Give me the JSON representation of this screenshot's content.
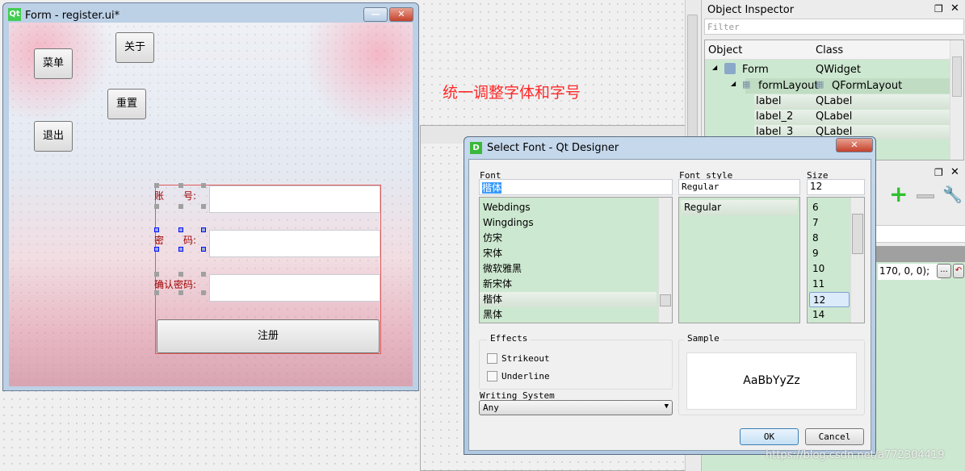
{
  "form_window": {
    "title": "Form - register.ui*",
    "buttons": {
      "menu": "菜单",
      "about": "关于",
      "reset": "重置",
      "exit": "退出",
      "register": "注册"
    },
    "labels": {
      "account": "账　　号:",
      "password": "密　　码:",
      "confirm": "确认密码:"
    }
  },
  "annotation": "统一调整字体和字号",
  "object_inspector": {
    "title": "Object Inspector",
    "filter_placeholder": "Filter",
    "columns": [
      "Object",
      "Class"
    ],
    "rows": [
      {
        "object": "Form",
        "class": "QWidget"
      },
      {
        "object": "formLayout",
        "class": "QFormLayout"
      },
      {
        "object": "label",
        "class": "QLabel"
      },
      {
        "object": "label_2",
        "class": "QLabel"
      },
      {
        "object": "label_3",
        "class": "QLabel"
      }
    ]
  },
  "property_editor": {
    "value_fragment": "170, 0, 0);",
    "more_label": "..."
  },
  "font_dialog": {
    "title": "Select Font - Qt Designer",
    "font_label": "Font",
    "font_value": "楷体",
    "fonts": [
      "Webdings",
      "Wingdings",
      "仿宋",
      "宋体",
      "微软雅黑",
      "新宋体",
      "楷体",
      "黑体"
    ],
    "selected_font": "楷体",
    "style_label": "Font style",
    "style_value": "Regular",
    "styles": [
      "Regular"
    ],
    "size_label": "Size",
    "size_value": "12",
    "sizes": [
      "6",
      "7",
      "8",
      "9",
      "10",
      "11",
      "12",
      "14"
    ],
    "effects_label": "Effects",
    "strikeout_label": "Strikeout",
    "strikeout_checked": false,
    "underline_label": "Underline",
    "underline_checked": false,
    "writing_system_label": "Writing System",
    "writing_system_value": "Any",
    "sample_label": "Sample",
    "sample_text": "AaBbYyZz",
    "ok_label": "OK",
    "cancel_label": "Cancel"
  },
  "watermark": "https://blog.csdn.net/a772304419"
}
